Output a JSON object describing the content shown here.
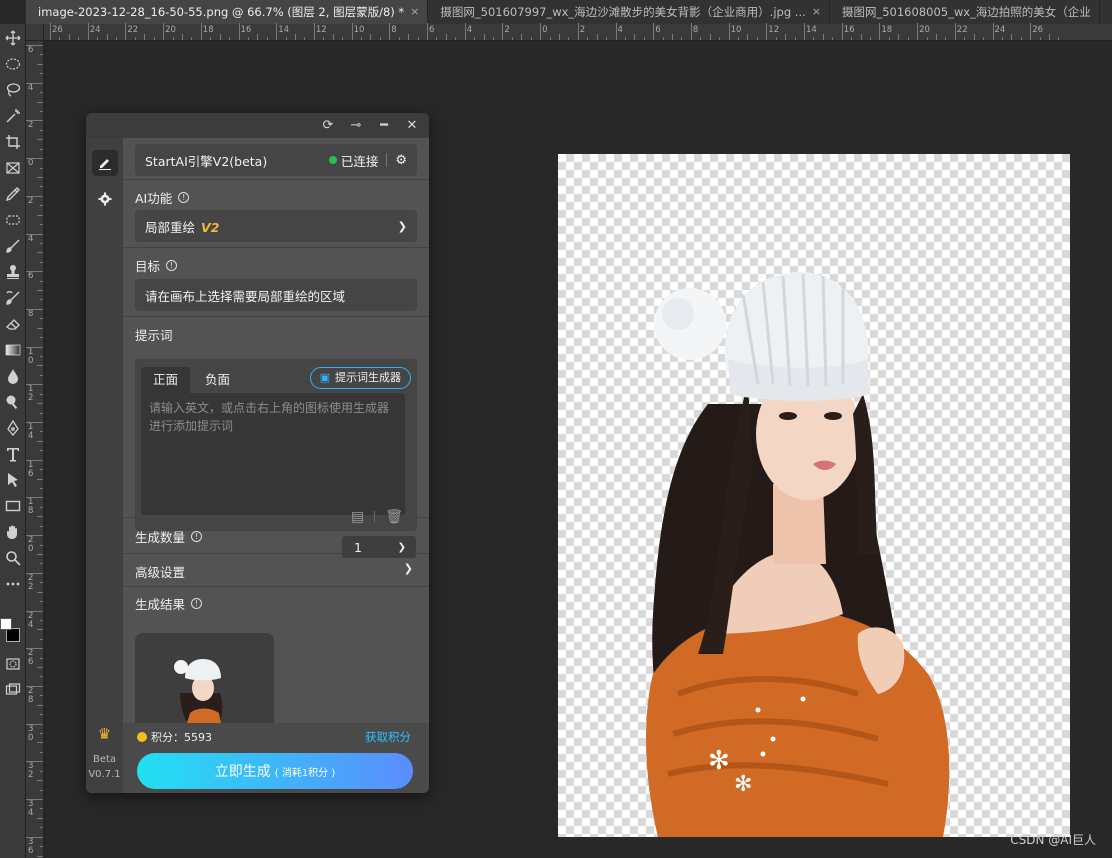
{
  "tabs": [
    {
      "label": "image-2023-12-28_16-50-55.png @ 66.7% (图层 2, 图层蒙版/8) *",
      "close": "×",
      "active": true
    },
    {
      "label": "摄图网_501607997_wx_海边沙滩散步的美女背影（企业商用）.jpg ...",
      "close": "×",
      "active": false
    },
    {
      "label": "摄图网_501608005_wx_海边拍照的美女（企业",
      "close": "",
      "active": false
    }
  ],
  "ruler": {
    "h_labels": [
      "26",
      "24",
      "22",
      "20",
      "18",
      "16",
      "14",
      "12",
      "10",
      "8",
      "6",
      "4",
      "2",
      "0",
      "2",
      "4",
      "6",
      "8",
      "10",
      "12",
      "14",
      "16",
      "18",
      "20",
      "22",
      "24",
      "26"
    ],
    "v_labels": [
      "6",
      "4",
      "2",
      "0",
      "2",
      "4",
      "6",
      "8",
      "1 0",
      "1 2",
      "1 4",
      "1 6",
      "1 8",
      "2 0",
      "2 2",
      "2 4",
      "2 6",
      "2 8",
      "3 0",
      "3 2",
      "3 4",
      "3 6"
    ]
  },
  "tools": [
    "move-icon",
    "marquee-icon",
    "lasso-icon",
    "magic-wand-icon",
    "crop-icon",
    "frame-icon",
    "eyedropper-icon",
    "healing-icon",
    "brush-icon",
    "stamp-icon",
    "history-brush-icon",
    "eraser-icon",
    "gradient-icon",
    "blur-icon",
    "dodge-icon",
    "pen-icon",
    "type-icon",
    "path-select-icon",
    "rectangle-icon",
    "hand-icon",
    "zoom-icon",
    "more-icon"
  ],
  "plugin": {
    "titlebar_icons": [
      "refresh-icon",
      "pin-icon",
      "minimize-icon",
      "close-icon"
    ],
    "engine": {
      "name": "StartAI引擎V2(beta)",
      "status": "已连接"
    },
    "ai_function": {
      "label": "AI功能",
      "value": "局部重绘",
      "version_tag": "V2"
    },
    "target": {
      "label": "目标",
      "value": "请在画布上选择需要局部重绘的区域"
    },
    "prompt": {
      "label": "提示词",
      "tab_positive": "正面",
      "tab_negative": "负面",
      "generator_button": "提示词生成器",
      "placeholder": "请输入英文，或点击右上角的图标使用生成器进行添加提示词"
    },
    "count": {
      "label": "生成数量",
      "value": "1"
    },
    "advanced": {
      "label": "高级设置"
    },
    "results": {
      "label": "生成结果"
    },
    "footer": {
      "points_text": "积分：5593",
      "get_points": "获取积分",
      "generate_label": "立即生成",
      "generate_sub": "( 消耗1积分 )"
    },
    "side": {
      "beta": "Beta",
      "version": "V0.7.1"
    }
  },
  "watermark": "CSDN @AI巨人",
  "colors": {
    "accent": "#2db3ff",
    "status_green": "#22c24d",
    "gradient_start": "#22e0f2",
    "gradient_end": "#5b8cff",
    "tag_orange": "#f3b53a"
  }
}
